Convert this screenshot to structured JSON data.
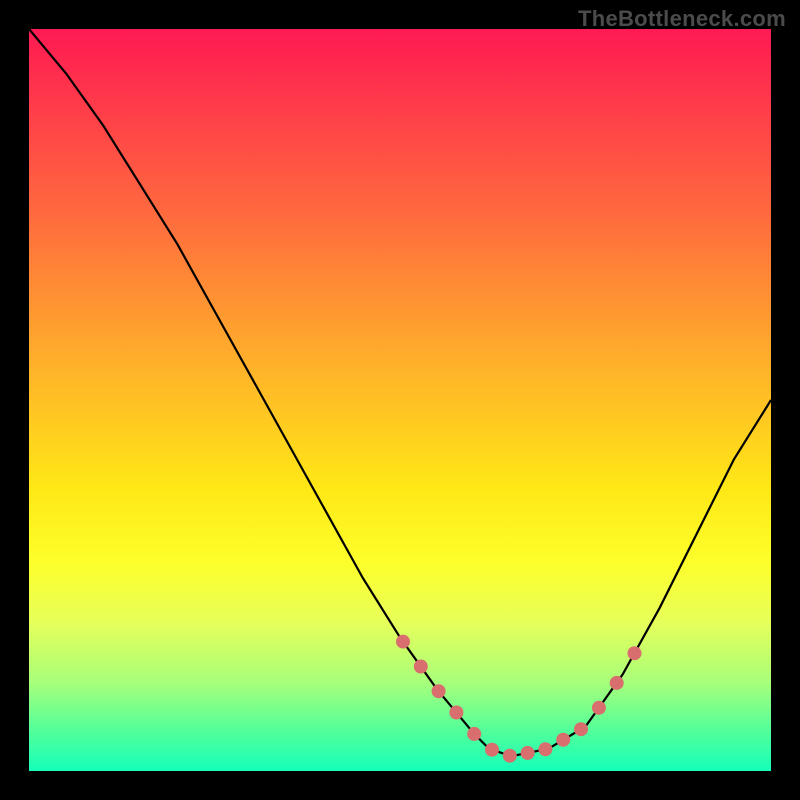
{
  "watermark": "TheBottleneck.com",
  "chart_data": {
    "type": "line",
    "title": "",
    "xlabel": "",
    "ylabel": "",
    "xlim": [
      0,
      100
    ],
    "ylim": [
      0,
      100
    ],
    "series": [
      {
        "name": "curve",
        "x": [
          0,
          5,
          10,
          15,
          20,
          25,
          30,
          35,
          40,
          45,
          50,
          55,
          60,
          62,
          65,
          70,
          75,
          80,
          85,
          90,
          95,
          100
        ],
        "y": [
          100,
          94,
          87,
          79,
          71,
          62,
          53,
          44,
          35,
          26,
          18,
          11,
          5,
          3,
          2,
          3,
          6,
          13,
          22,
          32,
          42,
          50
        ]
      }
    ],
    "green_band_y": 4.5,
    "dot_threshold_y": 18,
    "colors": {
      "curve": "#000000",
      "dots": "#d86e6e",
      "watermark": "#4b4b4b"
    }
  }
}
